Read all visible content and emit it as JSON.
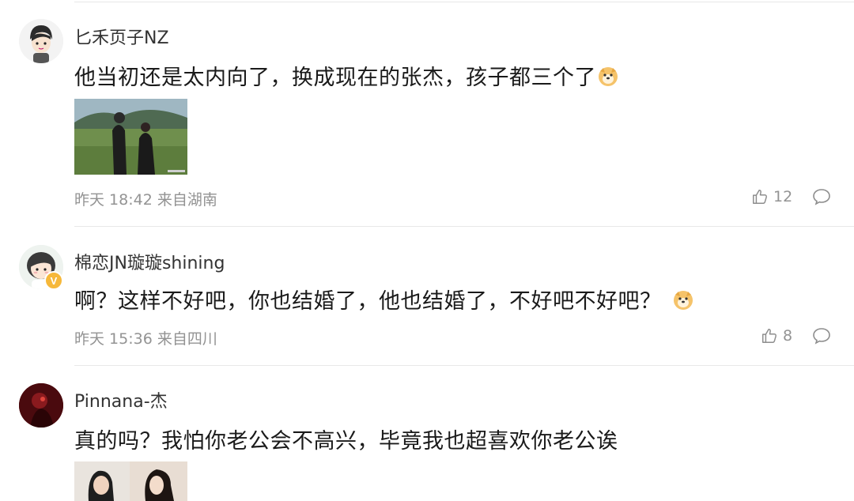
{
  "comments": [
    {
      "username": "匕禾页子NZ",
      "text": "他当初还是太内向了，换成现在的张杰，孩子都三个了",
      "emoji": "doge-emoji",
      "time": "昨天 18:42",
      "location": "来自湖南",
      "meta": "昨天 18:42 来自湖南",
      "likes": "12",
      "has_image": true
    },
    {
      "username": "棉恋JN璇璇shining",
      "text": "啊？这样不好吧，你也结婚了，他也结婚了，不好吧不好吧？",
      "emoji": "doge-emoji",
      "time": "昨天 15:36",
      "location": "来自四川",
      "meta": "昨天 15:36 来自四川",
      "likes": "8",
      "verified_badge": "V",
      "has_image": false
    },
    {
      "username": "Pinnana-杰",
      "text": "真的吗？我怕你老公会不高兴，毕竟我也超喜欢你老公诶",
      "has_image": true
    }
  ],
  "colors": {
    "meta": "#939393",
    "divider": "#e8e8e8",
    "badge": "#f6b83a"
  }
}
